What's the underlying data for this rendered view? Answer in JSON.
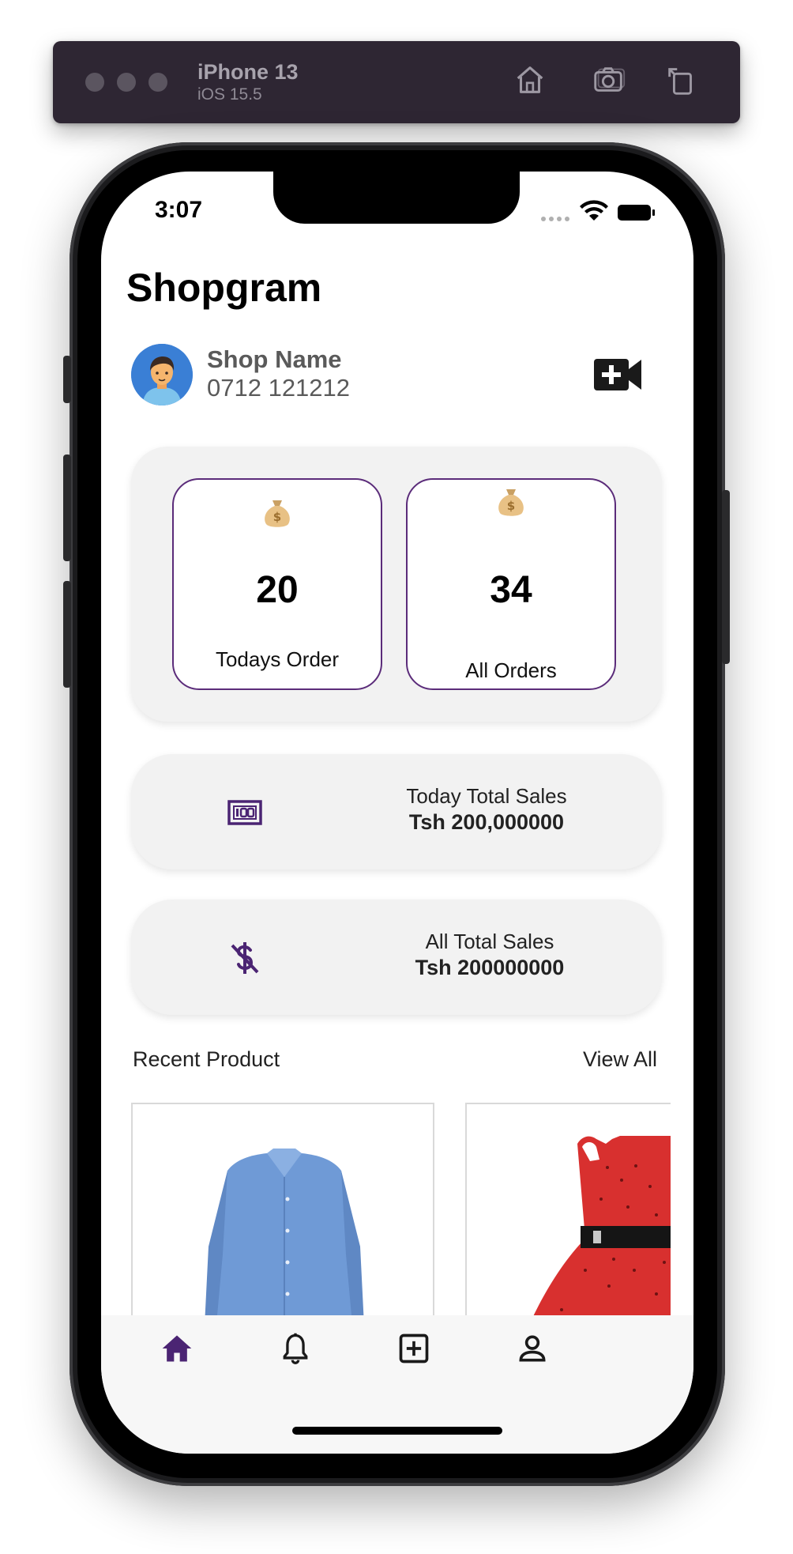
{
  "simulator": {
    "device": "iPhone 13",
    "os": "iOS 15.5",
    "buttons": [
      "home-icon",
      "camera-icon",
      "rotate-icon"
    ]
  },
  "status_bar": {
    "time": "3:07"
  },
  "header": {
    "title": "Shopgram"
  },
  "shop": {
    "name": "Shop Name",
    "phone": "0712 121212",
    "action_icon": "video-add-icon"
  },
  "stats": [
    {
      "value": "20",
      "label": "Todays Order",
      "icon": "money-bag-icon"
    },
    {
      "value": "34",
      "label": "All Orders",
      "icon": "money-bag-icon"
    }
  ],
  "sales": [
    {
      "label": "Today Total Sales",
      "value": "Tsh 200,000000",
      "icon": "cash-icon"
    },
    {
      "label": "All Total Sales",
      "value": "Tsh 200000000",
      "icon": "dollar-off-icon"
    }
  ],
  "recent": {
    "title": "Recent Product",
    "view_all": "View All"
  },
  "products": [
    {
      "image": "blue-shirt"
    },
    {
      "image": "red-polka-dress"
    }
  ],
  "nav": [
    {
      "icon": "home-icon",
      "active": true
    },
    {
      "icon": "bell-icon",
      "active": false
    },
    {
      "icon": "add-box-icon",
      "active": false
    },
    {
      "icon": "profile-icon",
      "active": false
    }
  ],
  "colors": {
    "accent": "#4b2473",
    "card_border": "#5b2c7a",
    "panel": "#f2f2f2"
  }
}
